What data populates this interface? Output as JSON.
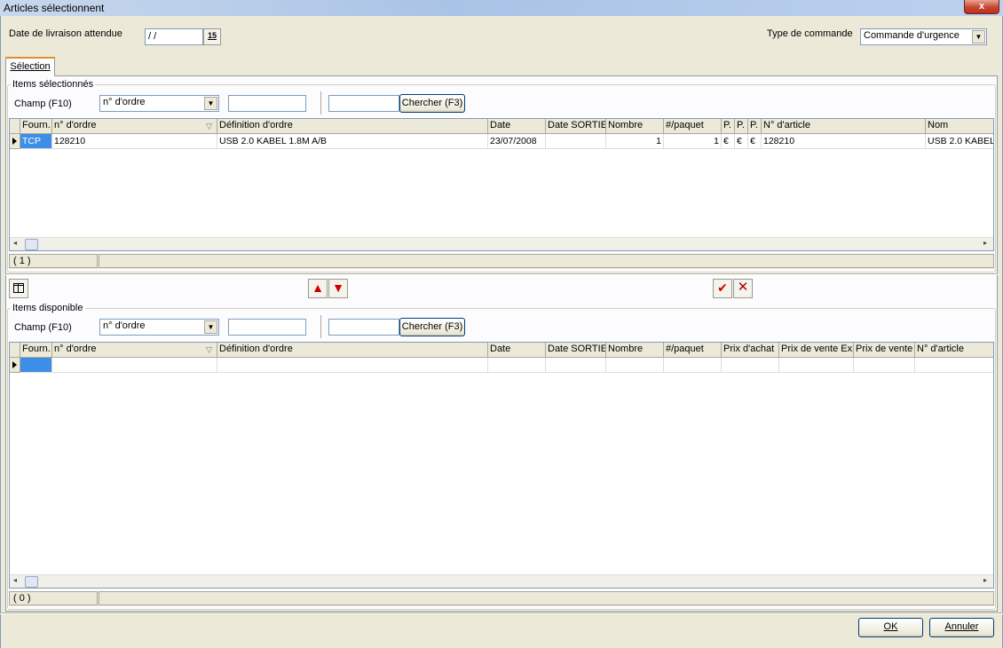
{
  "window": {
    "title": "Articles sélectionnent",
    "close": "x"
  },
  "header": {
    "delivery_label": "Date de livraison attendue",
    "delivery_value": "/ /",
    "calendar_glyph": "15",
    "order_type_label": "Type de commande",
    "order_type_value": "Commande d'urgence"
  },
  "tabs": [
    {
      "label": "Sélection"
    }
  ],
  "selected_items": {
    "group_title": "Items sélectionnés",
    "field_label": "Champ (F10)",
    "field_value": "n° d'ordre",
    "filter_value": "",
    "search_value": "",
    "search_button": "Chercher (F3)",
    "columns": [
      "Fourn.",
      "n° d'ordre",
      "Définition d'ordre",
      "Date",
      "Date SORTIE",
      "Nombre",
      "#/paquet",
      "P.",
      "P.",
      "P.",
      "N° d'article",
      "Nom"
    ],
    "rows": [
      [
        "TCP",
        "128210",
        "USB 2.0 KABEL 1.8M A/B",
        "23/07/2008",
        "",
        "1",
        "1",
        "€",
        "€",
        "€",
        "128210",
        "USB 2.0 KABEL"
      ]
    ],
    "status_count": "( 1 )"
  },
  "toolbar": {
    "up_glyph": "▲",
    "down_glyph": "▼",
    "check_glyph": "✔",
    "cancel_glyph": "✕"
  },
  "available_items": {
    "group_title": "Items disponible",
    "field_label": "Champ (F10)",
    "field_value": "n° d'ordre",
    "filter_value": "",
    "search_value": "",
    "search_button": "Chercher (F3)",
    "columns": [
      "Fourn.",
      "n° d'ordre",
      "Définition d'ordre",
      "Date",
      "Date SORTIE",
      "Nombre",
      "#/paquet",
      "Prix d'achat",
      "Prix de vente Ex",
      "Prix de vente",
      "N° d'article"
    ],
    "status_count": "( 0 )"
  },
  "footer": {
    "ok_label": "OK",
    "cancel_label": "Annuler"
  },
  "colors": {
    "selection": "#3d8ee6",
    "title_bar": "#a9c3e6",
    "close_button": "#c8452f"
  },
  "icons": {
    "sort": "triangle-down-icon",
    "dropdown": "chevron-down-icon"
  }
}
